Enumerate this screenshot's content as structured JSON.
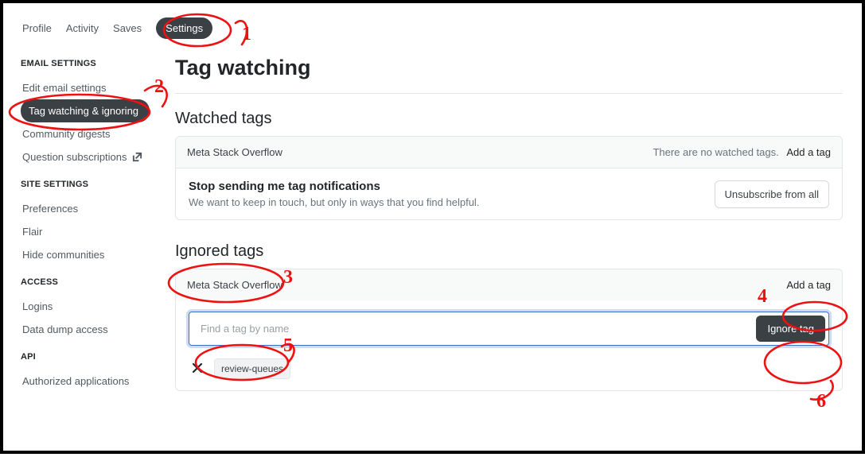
{
  "tabs": {
    "profile": "Profile",
    "activity": "Activity",
    "saves": "Saves",
    "settings": "Settings"
  },
  "sidebar": {
    "email_heading": "EMAIL SETTINGS",
    "edit_email": "Edit email settings",
    "tag_watching": "Tag watching & ignoring",
    "community_digests": "Community digests",
    "question_subs": "Question subscriptions",
    "site_heading": "SITE SETTINGS",
    "preferences": "Preferences",
    "flair": "Flair",
    "hide_communities": "Hide communities",
    "access_heading": "ACCESS",
    "logins": "Logins",
    "data_dump": "Data dump access",
    "api_heading": "API",
    "authorized_apps": "Authorized applications"
  },
  "page": {
    "title": "Tag watching"
  },
  "watched": {
    "section_title": "Watched tags",
    "site": "Meta Stack Overflow",
    "empty_msg": "There are no watched tags.",
    "add_tag": "Add a tag",
    "stop_title": "Stop sending me tag notifications",
    "stop_desc": "We want to keep in touch, but only in ways that you find helpful.",
    "unsubscribe": "Unsubscribe from all"
  },
  "ignored": {
    "section_title": "Ignored tags",
    "site": "Meta Stack Overflow",
    "add_tag": "Add a tag",
    "input_placeholder": "Find a tag by name",
    "ignore_btn": "Ignore tag",
    "tag0": "review-queues"
  },
  "annotations": {
    "n1": "1",
    "n2": "2",
    "n3": "3",
    "n4": "4",
    "n5": "5",
    "n6": "6"
  }
}
